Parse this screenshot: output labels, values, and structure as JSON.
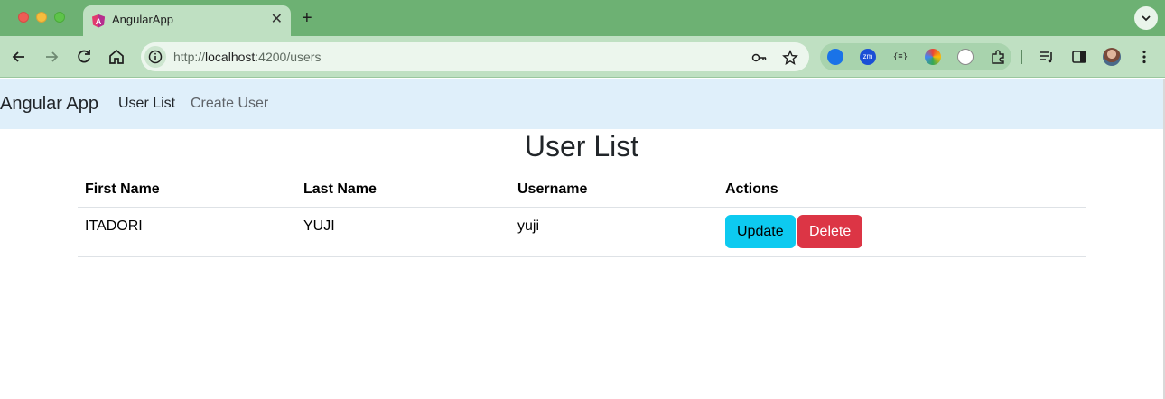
{
  "browser": {
    "tab_title": "AngularApp",
    "new_tab_label": "+",
    "close_label": "✕",
    "url_prefix": "http://",
    "url_host": "localhost",
    "url_rest": ":4200/users",
    "colors": {
      "frame": "#6db173",
      "toolbar": "#bfe0c2"
    }
  },
  "navbar": {
    "brand": "Angular App",
    "links": [
      {
        "label": "User List",
        "active": true
      },
      {
        "label": "Create User",
        "active": false
      }
    ]
  },
  "main": {
    "title": "User List",
    "table": {
      "columns": [
        "First Name",
        "Last Name",
        "Username",
        "Actions"
      ],
      "rows": [
        {
          "first_name": "ITADORI",
          "last_name": "YUJI",
          "username": "yuji",
          "actions": [
            "Update",
            "Delete"
          ]
        }
      ]
    },
    "colors": {
      "update": "#0dcaf0",
      "delete": "#dc3545"
    }
  }
}
